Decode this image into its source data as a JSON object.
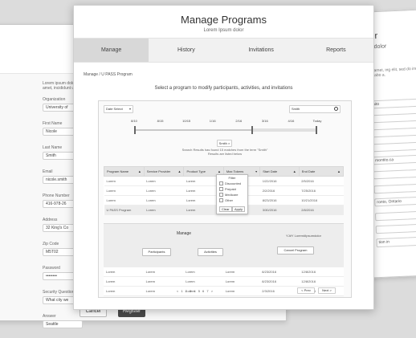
{
  "left_form": {
    "intro": "Lorem ipsum dolor sit amet, incididunt ut lab",
    "fields": [
      {
        "label": "Organization",
        "value": "University of"
      },
      {
        "label": "First Name",
        "value": "Nicole"
      },
      {
        "label": "Last Name",
        "value": "Smith"
      },
      {
        "label": "Email",
        "value": "nicole.smith"
      },
      {
        "label": "Phone Number",
        "value": "416-978-26"
      },
      {
        "label": "Address",
        "value": "32 King's Co"
      },
      {
        "label": "Zip Code",
        "value": "M5T02"
      },
      {
        "label": "Password",
        "value": "••••••••"
      },
      {
        "label": "Security Question",
        "value": "What city we"
      },
      {
        "label": "Answer",
        "value": "Seattle"
      }
    ],
    "cancel_label": "Cancel",
    "register_label": "Register"
  },
  "right_form": {
    "title": "ter",
    "subtitle": "m dolor",
    "para": "sit amet, ing elit, sed do incididunt ut labo a.",
    "inputs": [
      "nito",
      "",
      "",
      "",
      "montito.ca",
      "",
      "",
      "ronto, Ontario",
      "",
      ""
    ],
    "select": "tion in"
  },
  "main": {
    "title": "Manage Programs",
    "subtitle": "Lorem Ipsum dolor",
    "tabs": [
      {
        "label": "Manage"
      },
      {
        "label": "History"
      },
      {
        "label": "Invitations"
      },
      {
        "label": "Reports"
      }
    ],
    "breadcrumb": "Manage / U PASS Program",
    "instruction": "Select a program to modify participants, activities, and invitations",
    "status_select": "Date Select",
    "search_value": "Smith",
    "timeline_labels": [
      "8/10",
      "8/15",
      "10/15",
      "1/16",
      "2/16",
      "3/16",
      "4/16",
      "Today"
    ],
    "filter_chip": "Smith ×",
    "results_msg_1": "Search Results has found 15 matches from the term \"Smith\"",
    "results_msg_2": "Results are listed below",
    "table": {
      "headers": [
        "Program Name",
        "Service Provider",
        "Product Type",
        "Max Tokens",
        "Start Date",
        "End Date"
      ],
      "rows": [
        [
          "Lorem",
          "Lorem",
          "Lorem",
          "",
          "1/22/2016",
          "2/5/2016"
        ],
        [
          "Lorem",
          "Lorem",
          "Lorem",
          "",
          "2/2/2016",
          "7/25/2016"
        ],
        [
          "Lorem",
          "Lorem",
          "Lorem",
          "",
          "8/23/2016",
          "10/21/2016"
        ],
        [
          "U PASS Program",
          "Lorem",
          "Lorem",
          "",
          "3/30/2016",
          "2/8/2016"
        ]
      ],
      "rows_after": [
        [
          "Lorem",
          "Lorem",
          "Lorem",
          "Lorem",
          "8/23/2016",
          "12/8/2016"
        ],
        [
          "Lorem",
          "Lorem",
          "Lorem",
          "Lorem",
          "8/23/2016",
          "12/8/2016"
        ],
        [
          "Lorem",
          "Lorem",
          "Lorem",
          "Lorem",
          "2/3/2016",
          "8/15/2016"
        ]
      ]
    },
    "filter_popup": {
      "header": "Filter",
      "options": [
        "Discounted",
        "Prepaid",
        "Medicare",
        "Other"
      ],
      "clear": "Clear",
      "apply": "Apply"
    },
    "manage_panel": {
      "title": "Manage",
      "participants": "Participants",
      "activities": "Activities",
      "code": "YJ#Y Lorem#Ipsumdolor",
      "cancel_program": "Cancel Program"
    },
    "pagination": "< 1 2 3 4 5 6 7 >",
    "prev": "< Prev",
    "next": "Next >"
  }
}
